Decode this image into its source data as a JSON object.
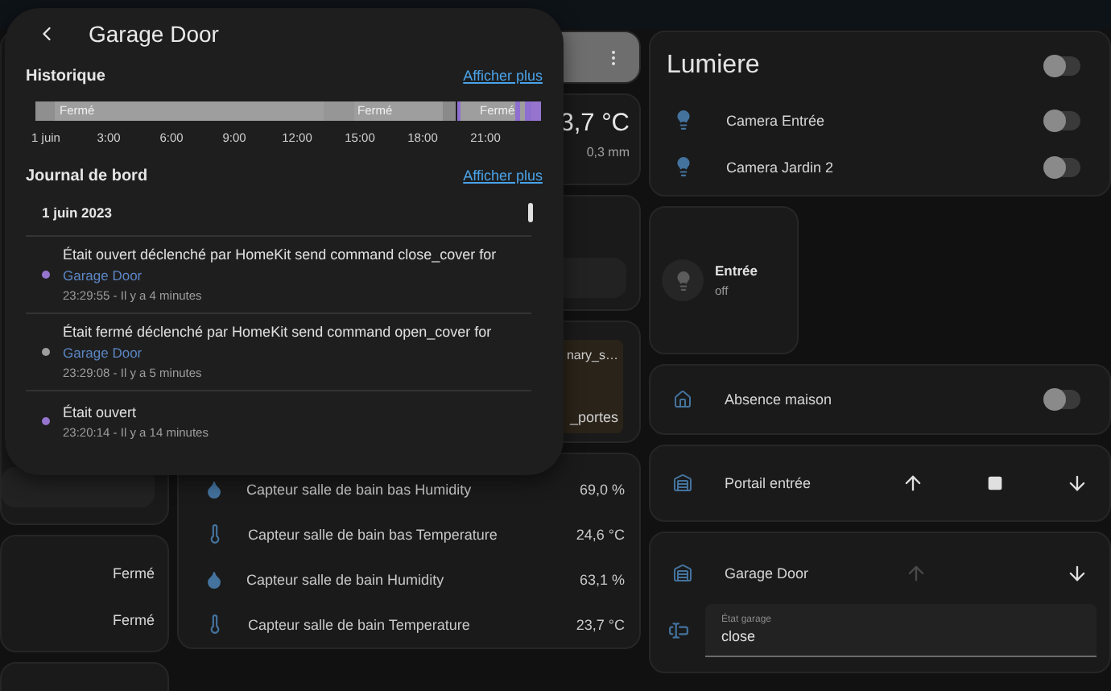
{
  "dialog": {
    "title": "Garage Door",
    "history": {
      "title": "Historique",
      "link": "Afficher plus",
      "segment_labels": [
        "Fermé",
        "Fermé",
        "Fermé"
      ],
      "ticks": [
        "1 juin",
        "3:00",
        "6:00",
        "9:00",
        "12:00",
        "15:00",
        "18:00",
        "21:00"
      ]
    },
    "logbook": {
      "title": "Journal de bord",
      "link": "Afficher plus",
      "date": "1 juin 2023",
      "entries": [
        {
          "message": "Était ouvert déclenché par HomeKit send command close_cover for",
          "entity": "Garage Door",
          "time": "23:29:55 - Il y a 4 minutes",
          "color": "#9575cd"
        },
        {
          "message": "Était fermé déclenché par HomeKit send command open_cover for",
          "entity": "Garage Door",
          "time": "23:29:08 - Il y a 5 minutes",
          "color": "#9e9e9e"
        },
        {
          "message": "Était ouvert",
          "time": "23:20:14 - Il y a 14 minutes",
          "color": "#9575cd"
        }
      ]
    }
  },
  "left_column": {
    "rows": [
      {
        "value": "Fermé"
      },
      {
        "value": "Fermé"
      }
    ]
  },
  "middle_column": {
    "weather": {
      "temperature": "3,7 °C",
      "precipitation": "0,3 mm"
    },
    "notice": {
      "line_1": "nary_s…",
      "line_2": "_portes"
    },
    "sensors": [
      {
        "kind": "humidity",
        "name": "Capteur salle de bain bas Humidity",
        "value": "69,0 %"
      },
      {
        "kind": "temperature",
        "name": "Capteur salle de bain bas Temperature",
        "value": "24,6 °C"
      },
      {
        "kind": "humidity",
        "name": "Capteur salle de bain Humidity",
        "value": "63,1 %"
      },
      {
        "kind": "temperature",
        "name": "Capteur salle de bain Temperature",
        "value": "23,7 °C"
      }
    ]
  },
  "right_column": {
    "lights": {
      "title": "Lumiere",
      "on": false,
      "items": [
        {
          "name": "Camera Entrée",
          "on": false
        },
        {
          "name": "Camera Jardin 2",
          "on": false
        }
      ]
    },
    "tile": {
      "name": "Entrée",
      "state": "off"
    },
    "absence": {
      "name": "Absence maison",
      "on": false
    },
    "covers": [
      {
        "name": "Portail entrée",
        "buttons": [
          {
            "kind": "up",
            "disabled": false
          },
          {
            "kind": "stop",
            "disabled": false
          },
          {
            "kind": "down",
            "disabled": false
          }
        ]
      },
      {
        "name": "Garage Door",
        "buttons": [
          {
            "kind": "up",
            "disabled": true
          },
          {
            "kind": "down",
            "disabled": false
          }
        ],
        "field": {
          "label": "État garage",
          "value": "close"
        }
      }
    ]
  }
}
